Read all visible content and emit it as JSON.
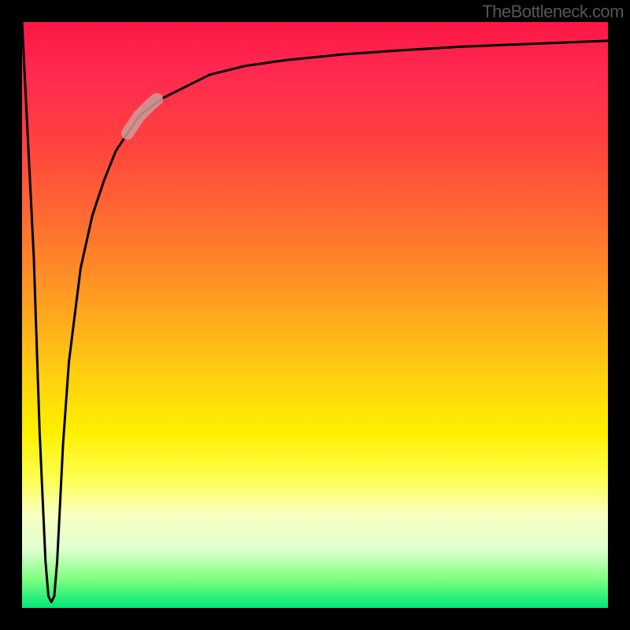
{
  "watermark": "TheBottleneck.com",
  "chart_data": {
    "type": "line",
    "title": "",
    "xlabel": "",
    "ylabel": "",
    "xlim": [
      0,
      100
    ],
    "ylim": [
      0,
      100
    ],
    "grid": false,
    "legend": false,
    "background": "rainbow-gradient",
    "series": [
      {
        "name": "bottleneck-curve",
        "color": "#000000",
        "x": [
          0,
          2,
          3,
          4,
          4.5,
          5,
          5.5,
          6,
          7,
          8,
          10,
          12,
          14,
          16,
          18,
          20,
          24,
          28,
          32,
          38,
          45,
          55,
          65,
          75,
          85,
          95,
          100
        ],
        "values": [
          100,
          60,
          30,
          8,
          2,
          1,
          2,
          8,
          28,
          42,
          58,
          67,
          73,
          78,
          81,
          84,
          87,
          89,
          91,
          92.5,
          93.5,
          94.5,
          95.2,
          95.8,
          96.2,
          96.6,
          96.8
        ]
      },
      {
        "name": "highlight-segment",
        "color": "#cf9c99",
        "x": [
          18,
          19,
          20,
          21,
          22,
          23
        ],
        "values": [
          81,
          82.5,
          84,
          85,
          86,
          86.8
        ]
      }
    ],
    "annotations": []
  }
}
